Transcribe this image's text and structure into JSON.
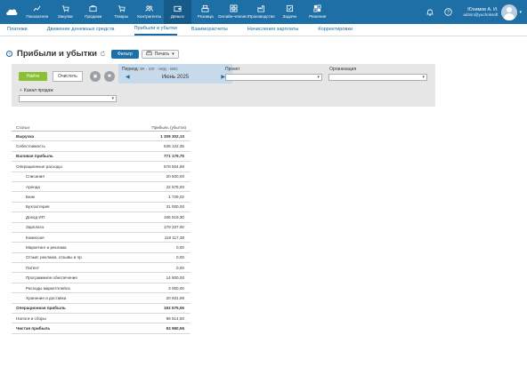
{
  "nav": {
    "items": [
      {
        "label": "Показатели",
        "icon": "chart-line-icon",
        "active": false
      },
      {
        "label": "Закупки",
        "icon": "cart-icon",
        "active": false
      },
      {
        "label": "Продажи",
        "icon": "briefcase-icon",
        "active": false
      },
      {
        "label": "Товары",
        "icon": "cart-icon",
        "active": false
      },
      {
        "label": "Контрагенты",
        "icon": "users-icon",
        "active": false
      },
      {
        "label": "Деньги",
        "icon": "wallet-icon",
        "active": true
      },
      {
        "label": "Розница",
        "icon": "cash-register-icon",
        "active": false
      },
      {
        "label": "Онлайн-чеклист",
        "icon": "grid-icon",
        "active": false
      },
      {
        "label": "Производство",
        "icon": "factory-icon",
        "active": false
      },
      {
        "label": "Задачи",
        "icon": "tasks-icon",
        "active": false
      },
      {
        "label": "Решения",
        "icon": "solutions-icon",
        "active": false
      }
    ],
    "user": {
      "name": "Юхимов А. И.",
      "email": "admin@yuchoksoft"
    }
  },
  "subnav": {
    "tabs": [
      {
        "label": "Платежи",
        "active": false
      },
      {
        "label": "Движение денежных средств",
        "active": false
      },
      {
        "label": "Прибыли и убытки",
        "active": true
      },
      {
        "label": "Взаиморасчеты",
        "active": false
      },
      {
        "label": "Начисления зарплаты",
        "active": false
      },
      {
        "label": "Корректировки",
        "active": false
      }
    ]
  },
  "page": {
    "title": "Прибыли и убытки",
    "filter_button": "Фильтр",
    "print_button": "Печать"
  },
  "filter": {
    "find_button": "Найти",
    "clear_button": "Очистить",
    "period_label": "Период:",
    "period_options": "вч · сег · нед · мес",
    "period_value": "Июнь 2025",
    "project_label": "Проект",
    "org_label": "Организация",
    "sales_channel_label": "Канал продаж"
  },
  "report": {
    "col_article": "Статьи",
    "col_profit": "Прибыль (убыток)",
    "rows": [
      {
        "name": "Выручка",
        "value": "1 309 302,10",
        "bold": true,
        "indent": false
      },
      {
        "name": "Себестоимость",
        "value": "538 122,35",
        "bold": false,
        "indent": false
      },
      {
        "name": "Валовая прибыль",
        "value": "771 179,75",
        "bold": true,
        "indent": false
      },
      {
        "name": "Операционные расходы",
        "value": "578 604,69",
        "bold": false,
        "indent": false
      },
      {
        "name": "Списания",
        "value": "20 500,00",
        "bold": false,
        "indent": true
      },
      {
        "name": "Аренда",
        "value": "22 675,00",
        "bold": false,
        "indent": true
      },
      {
        "name": "Банк",
        "value": "1 729,02",
        "bold": false,
        "indent": true
      },
      {
        "name": "Бухгалтерия",
        "value": "31 000,00",
        "bold": false,
        "indent": true
      },
      {
        "name": "Доход ИП",
        "value": "166 519,30",
        "bold": false,
        "indent": true
      },
      {
        "name": "Зарплата",
        "value": "179 337,00",
        "bold": false,
        "indent": true
      },
      {
        "name": "Комиссия",
        "value": "118 117,38",
        "bold": false,
        "indent": true
      },
      {
        "name": "Маркетинг и реклама",
        "value": "0,00",
        "bold": false,
        "indent": true
      },
      {
        "name": "Отзыв: реклама, отзывы и пр.",
        "value": "0,00",
        "bold": false,
        "indent": true
      },
      {
        "name": "Патент",
        "value": "0,00",
        "bold": false,
        "indent": true
      },
      {
        "name": "Программное обеспечение",
        "value": "14 800,00",
        "bold": false,
        "indent": true
      },
      {
        "name": "Расходы маркетплейса",
        "value": "3 000,00",
        "bold": false,
        "indent": true
      },
      {
        "name": "Хранение и доставка",
        "value": "20 931,99",
        "bold": false,
        "indent": true
      },
      {
        "name": "Операционная прибыль",
        "value": "192 575,06",
        "bold": true,
        "indent": false
      },
      {
        "name": "Налоги и сборы",
        "value": "98 614,50",
        "bold": false,
        "indent": false
      },
      {
        "name": "Чистая прибыль",
        "value": "93 960,56",
        "bold": true,
        "indent": false
      }
    ]
  },
  "colors": {
    "nav_bg": "#1d6fa5",
    "nav_active": "#165a89",
    "find_button": "#8bc034",
    "period_bg": "#c7daeb"
  }
}
